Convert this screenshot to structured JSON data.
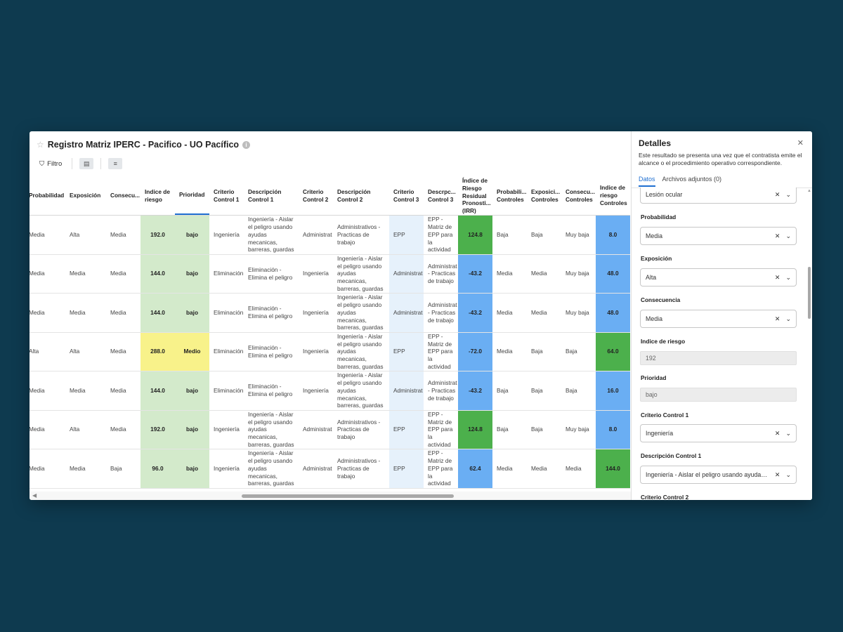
{
  "title": "Registro Matriz IPERC - Pacifico - UO Pacífico",
  "toolbar": {
    "filter_label": "Filtro"
  },
  "columns": {
    "probabilidad": "Probabilidad",
    "exposicion": "Exposición",
    "consecuencia": "Consecu...",
    "indice_riesgo": "Indice de riesgo",
    "prioridad": "Prioridad",
    "criterio1": "Criterio Control 1",
    "desc1": "Descripción Control 1",
    "criterio2": "Criterio Control 2",
    "desc2": "Descripción Control 2",
    "criterio3": "Criterio Control 3",
    "desc3": "Descrpc... Control 3",
    "irr": "Índice de Riesgo Residual Pronosti... (IRR)",
    "prob_controles": "Probabili... Controles",
    "expo_controles": "Exposici... Controles",
    "cons_controles": "Consecu... Controles",
    "ir_controles": "Indice de riesgo Controles"
  },
  "rows": [
    {
      "prob": "Media",
      "exp": "Alta",
      "cons": "Media",
      "ir": "192.0",
      "prio": "bajo",
      "cc1": "Ingeniería",
      "dc1": "Ingeniería - Aislar el peligro usando ayudas mecanicas, barreras, guardas",
      "cc2": "Administrat",
      "dc2": "Administrativos - Practicas de trabajo",
      "cc3": "EPP",
      "dc3": "EPP - Matriz de EPP para la actividad",
      "irr": "124.8",
      "pc": "Baja",
      "ec": "Baja",
      "csc": "Muy baja",
      "irc": "8.0",
      "ir_color": "green-l",
      "irr_color": "green",
      "irc_color": "blue"
    },
    {
      "prob": "Media",
      "exp": "Media",
      "cons": "Media",
      "ir": "144.0",
      "prio": "bajo",
      "cc1": "Eliminación",
      "dc1": "Eliminación - Elimina el peligro",
      "cc2": "Ingeniería",
      "dc2": "Ingeniería - Aislar el peligro usando ayudas mecanicas, barreras, guardas",
      "cc3": "Administrat",
      "dc3": "Administrat - Practicas de trabajo",
      "irr": "-43.2",
      "pc": "Media",
      "ec": "Media",
      "csc": "Muy baja",
      "irc": "48.0",
      "ir_color": "green-l",
      "irr_color": "blue",
      "irc_color": "blue"
    },
    {
      "prob": "Media",
      "exp": "Media",
      "cons": "Media",
      "ir": "144.0",
      "prio": "bajo",
      "cc1": "Eliminación",
      "dc1": "Eliminación - Elimina el peligro",
      "cc2": "Ingeniería",
      "dc2": "Ingeniería - Aislar el peligro usando ayudas mecanicas, barreras, guardas",
      "cc3": "Administrat",
      "dc3": "Administrat - Practicas de trabajo",
      "irr": "-43.2",
      "pc": "Media",
      "ec": "Media",
      "csc": "Muy baja",
      "irc": "48.0",
      "ir_color": "green-l",
      "irr_color": "blue",
      "irc_color": "blue"
    },
    {
      "prob": "Alta",
      "exp": "Alta",
      "cons": "Media",
      "ir": "288.0",
      "prio": "Medio",
      "cc1": "Eliminación",
      "dc1": "Eliminación - Elimina el peligro",
      "cc2": "Ingeniería",
      "dc2": "Ingeniería - Aislar el peligro usando ayudas mecanicas, barreras, guardas",
      "cc3": "EPP",
      "dc3": "EPP - Matriz de EPP para la actividad",
      "irr": "-72.0",
      "pc": "Media",
      "ec": "Baja",
      "csc": "Baja",
      "irc": "64.0",
      "ir_color": "yellow",
      "irr_color": "blue",
      "irc_color": "green"
    },
    {
      "prob": "Media",
      "exp": "Media",
      "cons": "Media",
      "ir": "144.0",
      "prio": "bajo",
      "cc1": "Eliminación",
      "dc1": "Eliminación - Elimina el peligro",
      "cc2": "Ingeniería",
      "dc2": "Ingeniería - Aislar el peligro usando ayudas mecanicas, barreras, guardas",
      "cc3": "Administrat",
      "dc3": "Administrat - Practicas de trabajo",
      "irr": "-43.2",
      "pc": "Baja",
      "ec": "Baja",
      "csc": "Baja",
      "irc": "16.0",
      "ir_color": "green-l",
      "irr_color": "blue",
      "irc_color": "blue"
    },
    {
      "prob": "Media",
      "exp": "Alta",
      "cons": "Media",
      "ir": "192.0",
      "prio": "bajo",
      "cc1": "Ingeniería",
      "dc1": "Ingeniería - Aislar el peligro usando ayudas mecanicas, barreras, guardas",
      "cc2": "Administrat",
      "dc2": "Administrativos - Practicas de trabajo",
      "cc3": "EPP",
      "dc3": "EPP - Matriz de EPP para la actividad",
      "irr": "124.8",
      "pc": "Baja",
      "ec": "Baja",
      "csc": "Muy baja",
      "irc": "8.0",
      "ir_color": "green-l",
      "irr_color": "green",
      "irc_color": "blue"
    },
    {
      "prob": "Media",
      "exp": "Media",
      "cons": "Baja",
      "ir": "96.0",
      "prio": "bajo",
      "cc1": "Ingeniería",
      "dc1": "Ingeniería - Aislar el peligro usando ayudas mecanicas, barreras, guardas",
      "cc2": "Administrat",
      "dc2": "Administrativos - Practicas de trabajo",
      "cc3": "EPP",
      "dc3": "EPP - Matriz de EPP para la actividad",
      "irr": "62.4",
      "pc": "Media",
      "ec": "Media",
      "csc": "Media",
      "irc": "144.0",
      "ir_color": "green-l",
      "irr_color": "blue",
      "irc_color": "green"
    }
  ],
  "details": {
    "title": "Detalles",
    "description": "Este resultado se presenta una vez que el contratista emite el alcance o el procedimiento operativo correspondiente.",
    "tabs": [
      "Datos",
      "Archivos adjuntos (0)"
    ],
    "fields": {
      "top_value": "Lesión ocular",
      "probabilidad_label": "Probabilidad",
      "probabilidad_value": "Media",
      "exposicion_label": "Exposición",
      "exposicion_value": "Alta",
      "consecuencia_label": "Consecuencia",
      "consecuencia_value": "Media",
      "indice_label": "Indice de riesgo",
      "indice_value": "192",
      "prioridad_label": "Prioridad",
      "prioridad_value": "bajo",
      "criterio1_label": "Criterio Control 1",
      "criterio1_value": "Ingeniería",
      "desc1_label": "Descripción Control 1",
      "desc1_value": "Ingeniería - Aislar el peligro usando ayudas mecanicas, barreras, guardas",
      "criterio2_label": "Criterio Control 2"
    }
  }
}
